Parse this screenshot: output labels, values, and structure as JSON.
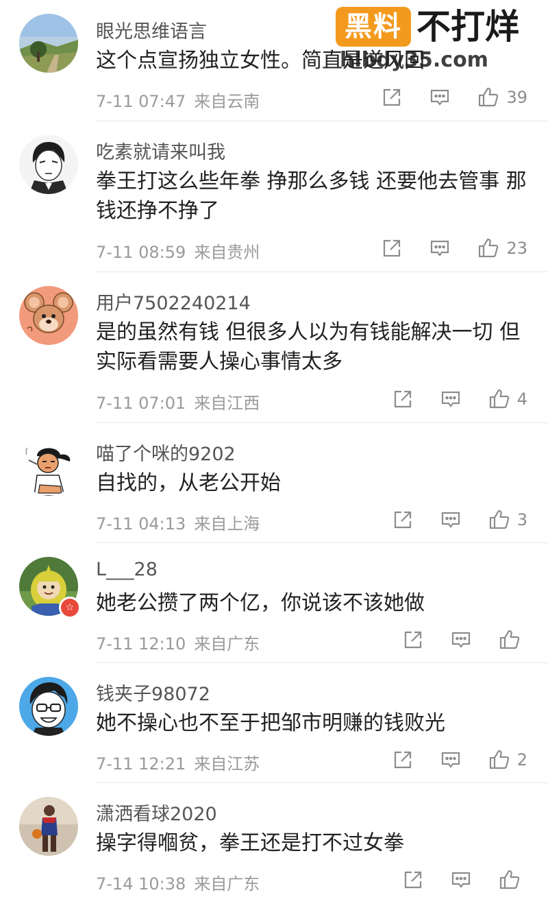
{
  "watermark": {
    "badge": "黑料",
    "title": "不打烊",
    "url": "hlbdy35.com"
  },
  "comments": [
    {
      "username": "眼光思维语言",
      "text": "这个点宣扬独立女性。简直是逆风回",
      "time": "7-11 07:47",
      "location": "来自云南",
      "likes": "39",
      "avatar": "landscape-photo"
    },
    {
      "username": "吃素就请来叫我",
      "text": "拳王打这么些年拳 挣那么多钱 还要他去管事 那钱还挣不挣了",
      "time": "7-11 08:59",
      "location": "来自贵州",
      "likes": "23",
      "avatar": "anime-character"
    },
    {
      "username": "用户7502240214",
      "text": "是的虽然有钱 但很多人以为有钱能解决一切 但实际看需要人操心事情太多",
      "time": "7-11 07:01",
      "location": "来自江西",
      "likes": "4",
      "avatar": "cartoon-mouse"
    },
    {
      "username": "喵了个咪的9202",
      "text": "自找的，从老公开始",
      "time": "7-11 04:13",
      "location": "来自上海",
      "likes": "3",
      "avatar": "cartoon-sketch"
    },
    {
      "username": "L___28",
      "text": "她老公攒了两个亿，你说该不该她做",
      "time": "7-11 12:10",
      "location": "来自广东",
      "likes": "",
      "avatar": "teletubby",
      "badge": "☆"
    },
    {
      "username": "钱夹子98072",
      "text": "她不操心也不至于把邹市明赚的钱败光",
      "time": "7-11 12:21",
      "location": "来自江苏",
      "likes": "2",
      "avatar": "cartoon-face-glasses"
    },
    {
      "username": "潇洒看球2020",
      "text": "操字得嗰贫，拳王还是打不过女拳",
      "time": "7-14 10:38",
      "location": "来自广东",
      "likes": "",
      "avatar": "basketball-player"
    }
  ]
}
